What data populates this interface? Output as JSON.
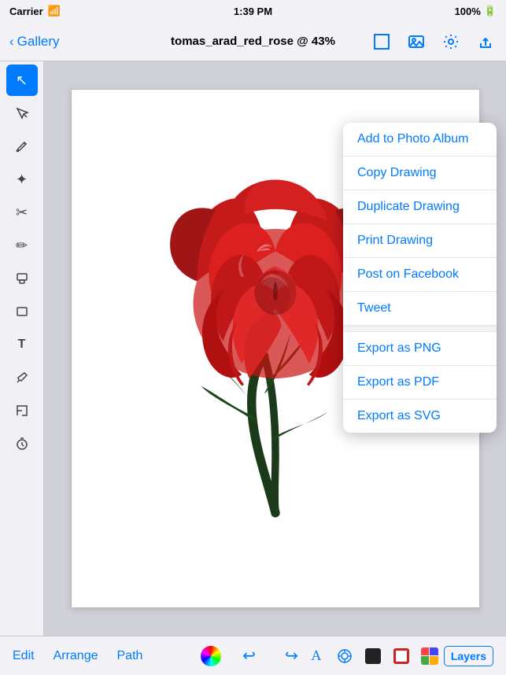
{
  "status_bar": {
    "carrier": "Carrier",
    "time": "1:39 PM",
    "battery": "100%"
  },
  "nav": {
    "back_label": "Gallery",
    "title": "tomas_arad_red_rose @ 43%"
  },
  "toolbar": {
    "tools": [
      {
        "name": "select",
        "icon": "↖",
        "active": true
      },
      {
        "name": "subselect",
        "icon": "⤢",
        "active": false
      },
      {
        "name": "pen",
        "icon": "✒",
        "active": false
      },
      {
        "name": "node",
        "icon": "✦",
        "active": false
      },
      {
        "name": "scissors",
        "icon": "✂",
        "active": false
      },
      {
        "name": "pencil",
        "icon": "✏",
        "active": false
      },
      {
        "name": "brush",
        "icon": "⬜",
        "active": false
      },
      {
        "name": "rectangle",
        "icon": "□",
        "active": false
      },
      {
        "name": "text",
        "icon": "T",
        "active": false
      },
      {
        "name": "eyedropper",
        "icon": "💉",
        "active": false
      },
      {
        "name": "zoom",
        "icon": "⤡",
        "active": false
      },
      {
        "name": "timer",
        "icon": "⏱",
        "active": false
      }
    ]
  },
  "dropdown_menu": {
    "items": [
      {
        "label": "Add to Photo Album",
        "section": 1
      },
      {
        "label": "Copy Drawing",
        "section": 1
      },
      {
        "label": "Duplicate Drawing",
        "section": 1
      },
      {
        "label": "Print Drawing",
        "section": 1
      },
      {
        "label": "Post on Facebook",
        "section": 1
      },
      {
        "label": "Tweet",
        "section": 1
      },
      {
        "label": "Export as PNG",
        "section": 2
      },
      {
        "label": "Export as PDF",
        "section": 2
      },
      {
        "label": "Export as SVG",
        "section": 2
      }
    ]
  },
  "bottom_toolbar": {
    "edit_label": "Edit",
    "arrange_label": "Arrange",
    "path_label": "Path",
    "layers_label": "Layers"
  }
}
